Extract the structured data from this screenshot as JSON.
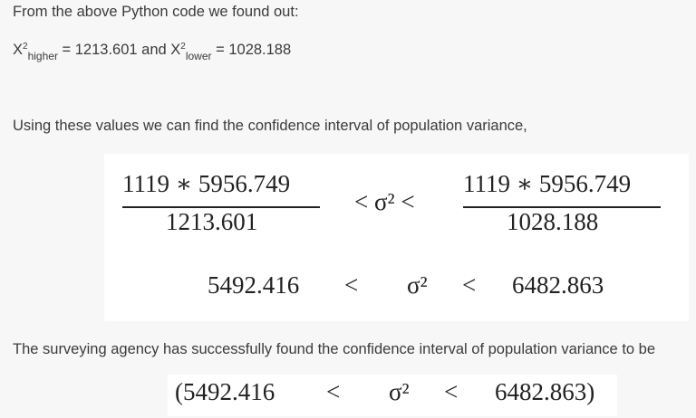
{
  "text": {
    "intro": "From the above Python code we found out:",
    "x2_symbol": "X",
    "sup_2": "2",
    "higher_sub": "higher",
    "higher_eq": " = 1213.601 and ",
    "lower_sub": "lower",
    "lower_eq": " = 1028.188",
    "interval_intro": "Using these values we can find the confidence interval of population variance,",
    "conclusion": "The surveying agency has successfully found the confidence interval of population variance to be"
  },
  "formula": {
    "left_numerator": "1119 ∗ 5956.749",
    "left_denominator": "1213.601",
    "middle": "< σ² <",
    "right_numerator": "1119 ∗ 5956.749",
    "right_denominator": "1028.188",
    "row2_left": "5492.416",
    "row2_lt1": "<",
    "row2_sigma": "σ²",
    "row2_lt2": "<",
    "row2_right": "6482.863"
  },
  "final": {
    "open": "(5492.416",
    "lt1": "<",
    "sigma": "σ²",
    "lt2": "<",
    "close": "6482.863)"
  }
}
